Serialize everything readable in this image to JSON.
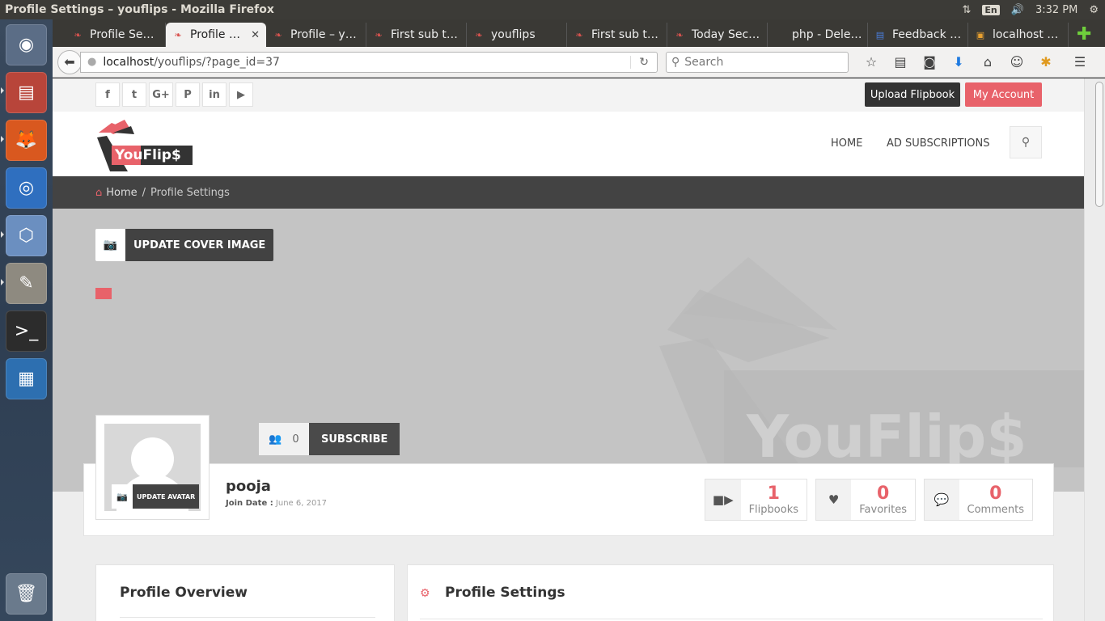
{
  "os": {
    "window_title": "Profile Settings – youflips - Mozilla Firefox",
    "lang": "En",
    "clock": "3:32 PM"
  },
  "browser": {
    "tabs": [
      {
        "label": "Profile Se…",
        "active": false
      },
      {
        "label": "Profile …",
        "active": true
      },
      {
        "label": "Profile – y…",
        "active": false
      },
      {
        "label": "First sub t…",
        "active": false
      },
      {
        "label": "youflips",
        "active": false
      },
      {
        "label": "First sub t…",
        "active": false
      },
      {
        "label": "Today Sec…",
        "active": false
      },
      {
        "label": "php - Dele…",
        "active": false
      },
      {
        "label": "Feedback …",
        "active": false
      },
      {
        "label": "localhost …",
        "active": false
      }
    ],
    "url_host": "localhost",
    "url_path": "/youflips/?page_id=37",
    "search_placeholder": "Search"
  },
  "site": {
    "social": [
      "f",
      "t",
      "G+",
      "P",
      "in",
      "▶"
    ],
    "upload_button": "Upload Flipbook",
    "account_button": "My Account",
    "logo_text": "YouFlip$",
    "menu": [
      "HOME",
      "AD SUBSCRIPTIONS"
    ],
    "breadcrumb_home": "Home",
    "breadcrumb_sep": "/",
    "breadcrumb_current": "Profile Settings",
    "cover_button": "UPDATE COVER IMAGE",
    "watermark": "YouFlip$",
    "subscribers": "0",
    "subscribe_button": "SUBSCRIBE",
    "avatar_button": "UPDATE AVATAR",
    "username": "pooja",
    "join_label": "Join Date :",
    "join_value": "June 6, 2017",
    "stats": [
      {
        "value": "1",
        "label": "Flipbooks"
      },
      {
        "value": "0",
        "label": "Favorites"
      },
      {
        "value": "0",
        "label": "Comments"
      }
    ],
    "panel_overview": "Profile Overview",
    "panel_settings": "Profile Settings"
  },
  "colors": {
    "accent": "#e8626a",
    "dark": "#434343"
  }
}
